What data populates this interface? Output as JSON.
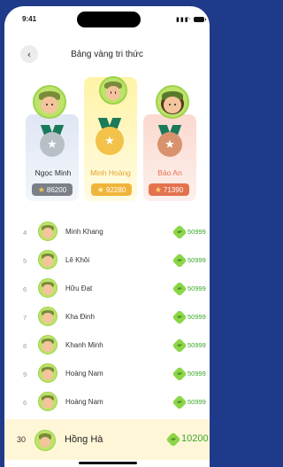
{
  "status": {
    "time": "9:41"
  },
  "header": {
    "title": "Bảng vàng tri thức",
    "back_icon": "‹"
  },
  "podium": [
    {
      "place": "silver",
      "name": "Ngọc Minh",
      "score": "86200",
      "color": "#b9bfc6",
      "score_color": "#7a7f88",
      "icon": "avatar-boy"
    },
    {
      "place": "gold",
      "name": "Minh Hoàng",
      "score": "92280",
      "color": "#f2c24a",
      "score_color": "#f1b43a",
      "icon": "avatar-boy"
    },
    {
      "place": "bronze",
      "name": "Bảo An",
      "score": "71390",
      "color": "#d9926e",
      "score_color": "#e4724e",
      "icon": "avatar-girl"
    }
  ],
  "list": [
    {
      "rank": "4",
      "name": "Minh Khang",
      "score": "50999",
      "xp_label": "XP"
    },
    {
      "rank": "5",
      "name": "Lê Khôi",
      "score": "50999",
      "xp_label": "XP"
    },
    {
      "rank": "6",
      "name": "Hữu Đạt",
      "score": "50999",
      "xp_label": "XP"
    },
    {
      "rank": "7",
      "name": "Kha Đinh",
      "score": "50999",
      "xp_label": "XP"
    },
    {
      "rank": "8",
      "name": "Khanh Minh",
      "score": "50999",
      "xp_label": "XP"
    },
    {
      "rank": "9",
      "name": "Hoàng Nam",
      "score": "50999",
      "xp_label": "XP"
    },
    {
      "rank": "6",
      "name": "Hoàng Nam",
      "score": "50999",
      "xp_label": "XP"
    }
  ],
  "me": {
    "rank": "30",
    "name": "Hồng Hà",
    "score": "10200",
    "xp_label": "XP"
  }
}
